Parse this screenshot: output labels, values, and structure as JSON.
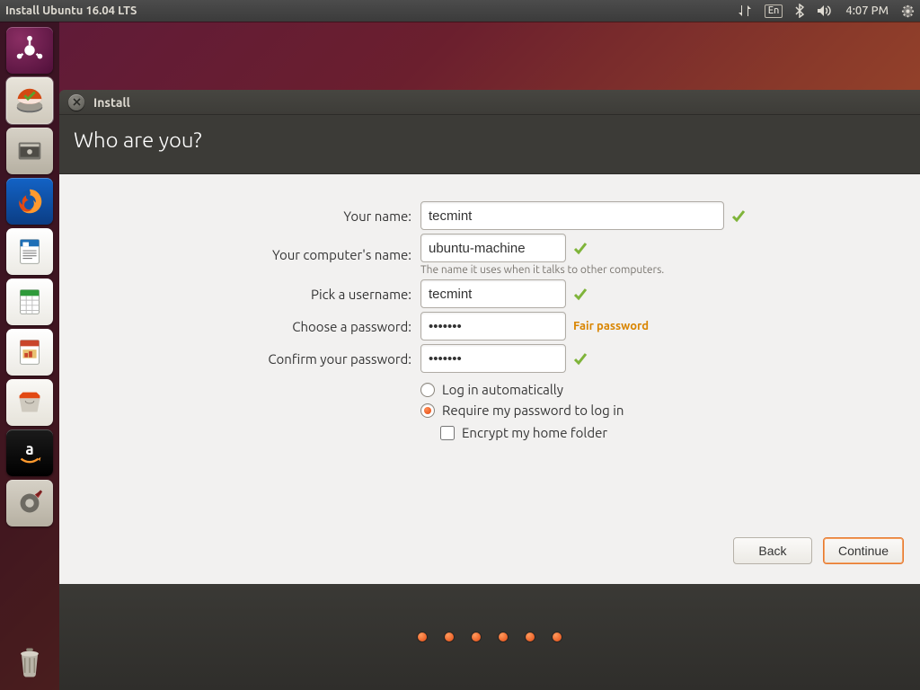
{
  "topbar": {
    "title": "Install Ubuntu 16.04 LTS",
    "lang": "En",
    "time": "4:07 PM"
  },
  "launcher": {
    "items": [
      {
        "name": "dash",
        "color": "#5b1241"
      },
      {
        "name": "ubiquity",
        "color": "#d9d4cc"
      },
      {
        "name": "files",
        "color": "#c8c3ba"
      },
      {
        "name": "firefox",
        "color": "#0f6cc9"
      },
      {
        "name": "writer",
        "color": "#ffffff"
      },
      {
        "name": "calc",
        "color": "#ffffff"
      },
      {
        "name": "impress",
        "color": "#ffffff"
      },
      {
        "name": "software",
        "color": "#f7f6f4"
      },
      {
        "name": "amazon",
        "color": "#111111"
      },
      {
        "name": "settings",
        "color": "#c8c3ba"
      }
    ]
  },
  "window": {
    "title": "Install",
    "heading": "Who are you?"
  },
  "form": {
    "your_name_label": "Your name:",
    "your_name_value": "tecmint",
    "computer_name_label": "Your computer's name:",
    "computer_name_value": "ubuntu-machine",
    "computer_name_hint": "The name it uses when it talks to other computers.",
    "username_label": "Pick a username:",
    "username_value": "tecmint",
    "password_label": "Choose a password:",
    "password_value": "•••••••",
    "password_strength": "Fair password",
    "confirm_label": "Confirm your password:",
    "confirm_value": "•••••••",
    "login_auto": "Log in automatically",
    "login_require": "Require my password to log in",
    "encrypt": "Encrypt my home folder",
    "login_mode": "require"
  },
  "footer": {
    "back": "Back",
    "continue": "Continue"
  },
  "progress_dots": 6
}
